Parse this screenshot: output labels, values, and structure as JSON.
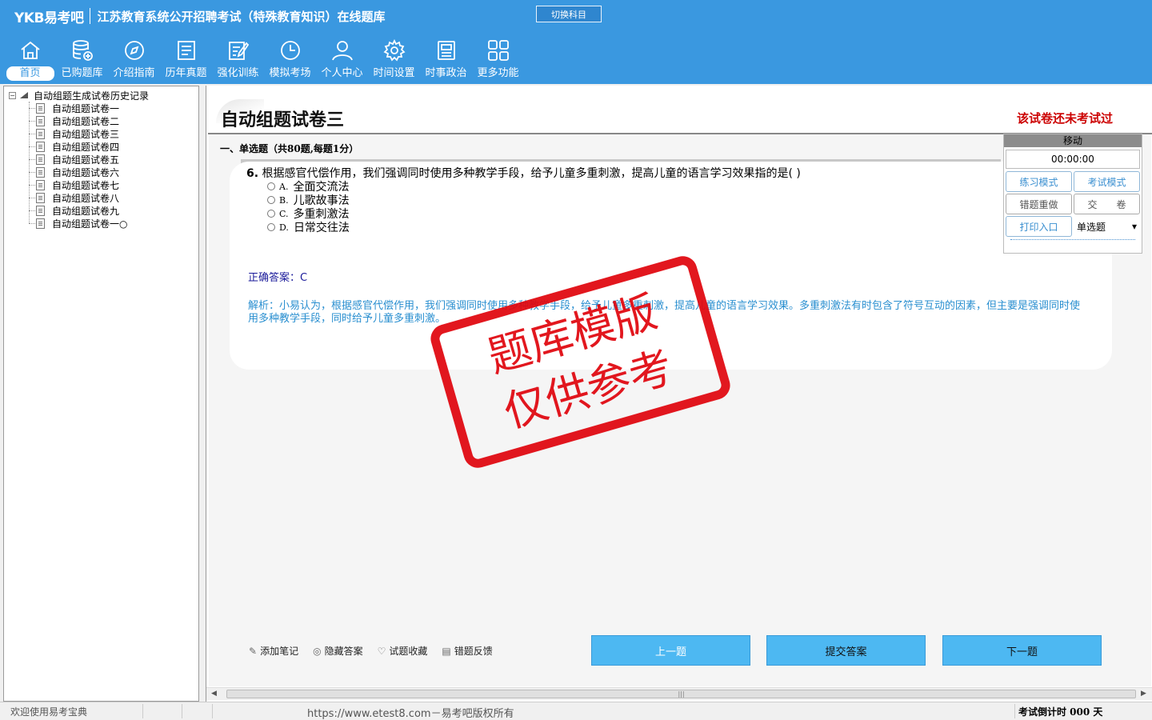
{
  "header": {
    "logo": "YKB易考吧",
    "title": "江苏教育系统公开招聘考试（特殊教育知识）在线题库",
    "switch_subject": "切换科目",
    "bg_color": "#3a98e0"
  },
  "nav": {
    "items": [
      {
        "label": "首页",
        "icon": "home-icon"
      },
      {
        "label": "已购题库",
        "icon": "database-icon"
      },
      {
        "label": "介绍指南",
        "icon": "compass-icon"
      },
      {
        "label": "历年真题",
        "icon": "list-doc-icon"
      },
      {
        "label": "强化训练",
        "icon": "edit-doc-icon"
      },
      {
        "label": "模拟考场",
        "icon": "clock-icon"
      },
      {
        "label": "个人中心",
        "icon": "user-icon"
      },
      {
        "label": "时间设置",
        "icon": "gear-icon"
      },
      {
        "label": "时事政治",
        "icon": "news-icon"
      },
      {
        "label": "更多功能",
        "icon": "grid-icon"
      }
    ]
  },
  "tree": {
    "root": "自动组题生成试卷历史记录",
    "toggle": "−",
    "items": [
      "自动组题试卷一",
      "自动组题试卷二",
      "自动组题试卷三",
      "自动组题试卷四",
      "自动组题试卷五",
      "自动组题试卷六",
      "自动组题试卷七",
      "自动组题试卷八",
      "自动组题试卷九",
      "自动组题试卷一○"
    ]
  },
  "paper": {
    "title": "自动组题试卷三",
    "status": "该试卷还未考试过",
    "section": "一、单选题（共80题,每题1分）"
  },
  "question": {
    "number": "6.",
    "text": "根据感官代偿作用，我们强调同时使用多种教学手段，给予儿童多重刺激，提高儿童的语言学习效果指的是( )",
    "options": [
      {
        "letter": "A.",
        "text": "全面交流法"
      },
      {
        "letter": "B.",
        "text": "儿歌故事法"
      },
      {
        "letter": "C.",
        "text": "多重刺激法"
      },
      {
        "letter": "D.",
        "text": "日常交往法"
      }
    ],
    "answer": "正确答案：C",
    "analysis": "解析：小易认为，根据感官代偿作用，我们强调同时使用多种教学手段，给予儿童多重刺激，提高儿童的语言学习效果。多重刺激法有时包含了符号互动的因素，但主要是强调同时使用多种教学手段，同时给予儿童多重刺激。"
  },
  "stamp": {
    "line1": "题库模版",
    "line2": "仅供参考",
    "color": "#e0060e"
  },
  "control": {
    "header": "移动",
    "timer": "00:00:00",
    "practice_mode": "练习模式",
    "exam_mode": "考试模式",
    "redo_wrong": "错题重做",
    "submit_paper": "交　　卷",
    "print": "打印入口",
    "type_select": "单选题"
  },
  "tools": {
    "add_note": "添加笔记",
    "hide_answer": "隐藏答案",
    "favorite": "试题收藏",
    "feedback": "错题反馈"
  },
  "buttons": {
    "prev": "上一题",
    "submit": "提交答案",
    "next": "下一题"
  },
  "scrollbar": {
    "grip": "|||"
  },
  "status": {
    "welcome": "欢迎使用易考宝典",
    "copyright": "https://www.etest8.com－易考吧版权所有",
    "countdown": "考试倒计时 000 天"
  }
}
